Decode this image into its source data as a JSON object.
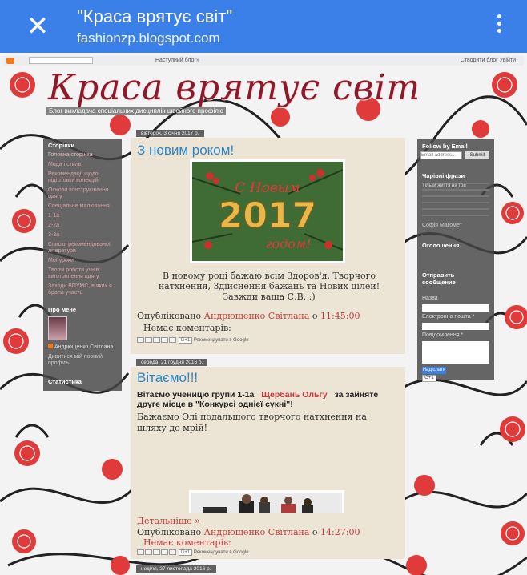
{
  "browser": {
    "close_icon": "close-icon",
    "title": "\"Краса врятує світ\"",
    "url": "fashionzp.blogspot.com",
    "menu_icon": "more-vert-icon"
  },
  "navbar": {
    "next_blog": "Наступний блог»",
    "create": "Створити блог  Увійти"
  },
  "blog": {
    "title": "Краса врятує світ",
    "description": "Блог викладача спеціальних дисциплін швейного профілю"
  },
  "left_sidebar": {
    "pages_heading": "Сторінки",
    "pages": [
      "Головна сторінка",
      "Мода і стиль",
      "Рекомендації щодо підготовки колекцій",
      "Основи конструювання одягу",
      "Спеціальне малювання",
      "1-1а",
      "2-2а",
      "3-3а",
      "Списки рекомендованої літератури",
      "Мої уроки",
      "Творчі роботи учнів: виготовлення одягу",
      "Заходи ВПУМС, в яких я брала участь"
    ],
    "about_heading": "Про мене",
    "about_name": "Андрющенко Світлана",
    "about_link": "Дивитися мій повний профіль",
    "stats_heading": "Статистика"
  },
  "right_sidebar": {
    "follow_heading": "Follow by Email",
    "email_placeholder": "Email address...",
    "submit": "Submit",
    "quotes_heading": "Чарівні фрази",
    "quote_text": "Тільки життя на той",
    "author": "Софія Магомет",
    "ads_heading": "Оголошення",
    "send_heading": "Отправить сообщение",
    "name_label": "Назва",
    "email_label": "Електронна пошта *",
    "message_label": "Повідомлення *",
    "send_button": "Надіслати"
  },
  "posts": [
    {
      "date": "вівторок, 3 січня 2017 р.",
      "title": "З новим роком!",
      "image_label": "С Новым 2017 годом!",
      "body": "В новому році бажаю всім Здоров'я,  Творчого натхнення, Здійснення бажань та Нових цілей! Завжди ваша С.В. :)",
      "published_prefix": "Опубліковано",
      "author": "Андрющенко Світлана",
      "at": "о",
      "time": "11:45:00",
      "comments": "Немає коментарів:",
      "recommend": "Рекомендувати в Google"
    },
    {
      "date": "середа, 21 грудня 2016 р.",
      "title": "Вітаємо!!!",
      "intro_a": "Вітаємо ученицю групи 1-1а",
      "student": "Щербань Ольгу",
      "intro_b": "за зайняте друге місце в \"Конкурсі однієї сукні\"!",
      "wish": "Бажаємо Олі подальшого творчого натхнення на шляху до мрій!",
      "more": "Детальніше »",
      "published_prefix": "Опубліковано",
      "author": "Андрющенко Світлана",
      "at": "о",
      "time": "14:27:00",
      "comments": "Немає коментарів:",
      "recommend": "Рекомендувати в Google"
    }
  ],
  "next_date": "неділя, 27 листопада 2016 р.",
  "colors": {
    "header": "#3b80e8",
    "blog_title": "#8b1a2c",
    "post_title": "#2a86c9",
    "link_red": "#c43a3a",
    "post_bg": "#ece5d6",
    "sidebar_bg": "#464646"
  }
}
